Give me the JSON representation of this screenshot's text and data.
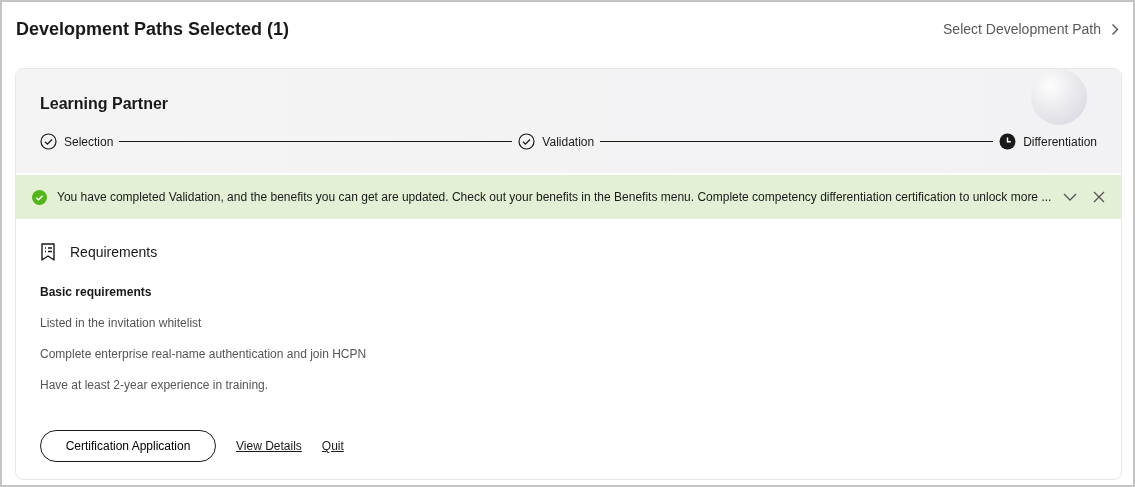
{
  "title": "Development Paths Selected (1)",
  "select_link": "Select Development Path",
  "path": {
    "name": "Learning Partner",
    "steps": [
      {
        "label": "Selection",
        "kind": "done"
      },
      {
        "label": "Validation",
        "kind": "done"
      },
      {
        "label": "Differentiation",
        "kind": "current"
      }
    ]
  },
  "alert": {
    "text": "You have completed Validation, and the benefits you can get are updated. Check out your benefits in the Benefits menu. Complete competency differentiation certification to unlock more ...",
    "expanded": false
  },
  "requirements": {
    "title": "Requirements",
    "group": "Basic requirements",
    "items": [
      "Listed in the invitation whitelist",
      "Complete enterprise real-name authentication and join HCPN",
      "Have at least 2-year experience in training."
    ]
  },
  "actions": {
    "primary": "Certification Application",
    "links": [
      "View Details",
      "Quit"
    ]
  }
}
